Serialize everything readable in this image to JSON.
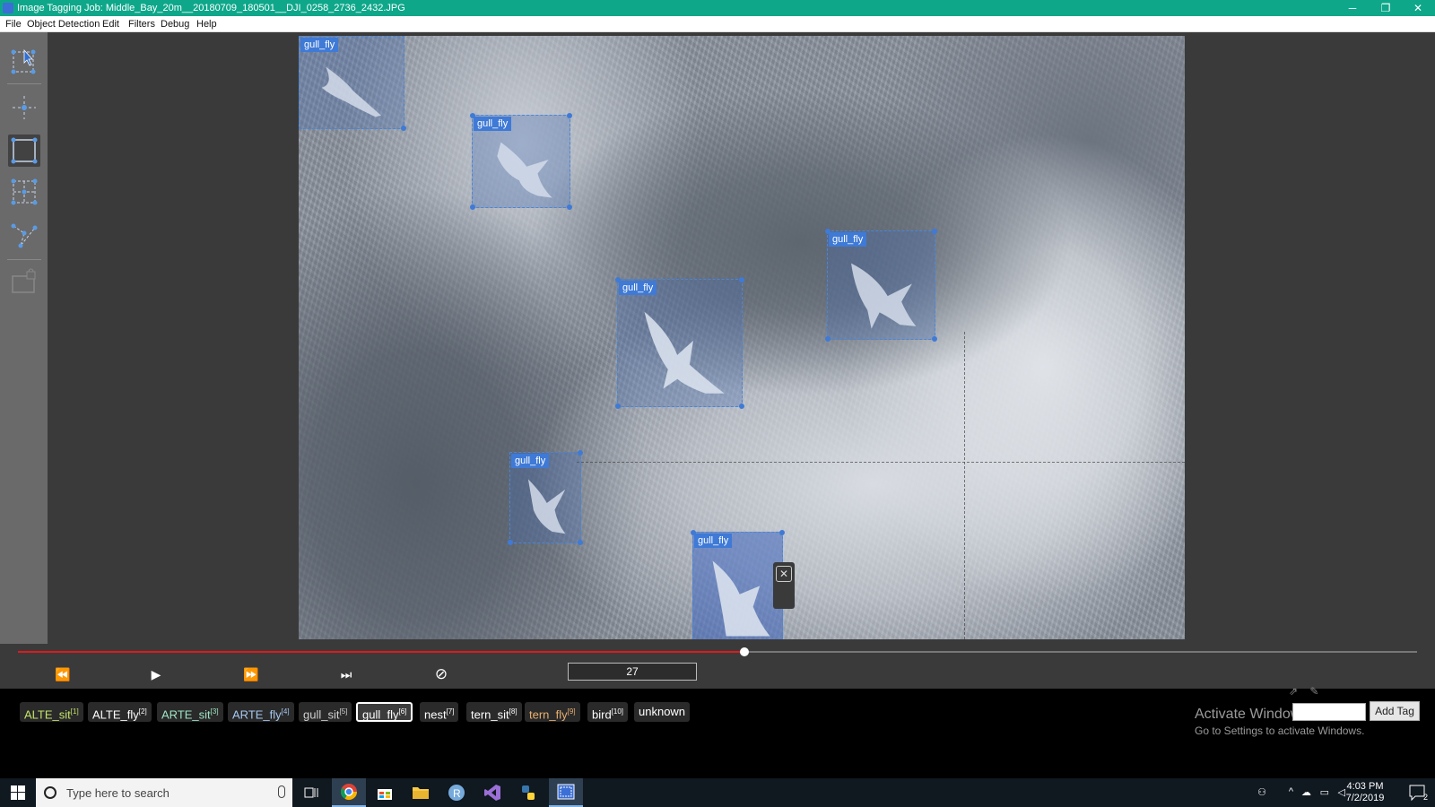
{
  "window": {
    "title": "Image Tagging Job: Middle_Bay_20m__20180709_180501__DJI_0258_2736_2432.JPG",
    "minimize": "─",
    "restore": "❐",
    "close": "✕"
  },
  "menu": [
    "File",
    "Object Detection",
    "Edit",
    "Filters",
    "Debug",
    "Help"
  ],
  "tools": [
    {
      "name": "select-tool-icon",
      "active": false
    },
    {
      "name": "point-tool-icon",
      "active": false
    },
    {
      "name": "rectangle-tool-icon",
      "active": true
    },
    {
      "name": "polygon-tool-icon",
      "active": false
    },
    {
      "name": "polyline-tool-icon",
      "active": false
    },
    {
      "name": "lock-region-icon",
      "active": false
    }
  ],
  "regions": [
    {
      "tag": "gull_fly"
    },
    {
      "tag": "gull_fly"
    },
    {
      "tag": "gull_fly"
    },
    {
      "tag": "gull_fly"
    },
    {
      "tag": "gull_fly"
    },
    {
      "tag": "gull_fly"
    }
  ],
  "region_colors": {
    "fill": "#466eb4",
    "border": "#4a86d8",
    "label": "#3f7ad6"
  },
  "timeline": {
    "progress_fraction": 0.519,
    "frame": "27",
    "buttons": {
      "prev": "⏪",
      "play": "▶",
      "next": "⏩",
      "next_tagged": "⏭",
      "skip": "⊘"
    }
  },
  "tags": [
    {
      "label": "ALTE_sit",
      "hotkey": "[1]",
      "color": "#c3e36a"
    },
    {
      "label": "ALTE_fly",
      "hotkey": "[2]",
      "color": "#ffffff"
    },
    {
      "label": "ARTE_sit",
      "hotkey": "[3]",
      "color": "#9fe3c4"
    },
    {
      "label": "ARTE_fly",
      "hotkey": "[4]",
      "color": "#a6c8f0"
    },
    {
      "label": "gull_sit",
      "hotkey": "[5]",
      "color": "#d0d0d0"
    },
    {
      "label": "gull_fly",
      "hotkey": "[6]",
      "color": "#ffffff"
    },
    {
      "label": "nest",
      "hotkey": "[7]",
      "color": "#ffffff"
    },
    {
      "label": "tern_sit",
      "hotkey": "[8]",
      "color": "#ffffff"
    },
    {
      "label": "tern_fly",
      "hotkey": "[9]",
      "color": "#e8b070"
    },
    {
      "label": "bird",
      "hotkey": "[10]",
      "color": "#ffffff"
    },
    {
      "label": "unknown",
      "hotkey": "",
      "color": "#ffffff"
    }
  ],
  "selected_tag": "gull_fly",
  "add_tag": {
    "input_value": "",
    "button_label": "Add Tag"
  },
  "watermark": {
    "line1": "Activate Windows",
    "line2": "Go to Settings to activate Windows."
  },
  "taskbar": {
    "search_placeholder": "Type here to search",
    "apps": [
      "task-view-icon",
      "chrome-icon",
      "store-icon",
      "file-explorer-icon",
      "r-app-icon",
      "visual-studio-icon",
      "python-app-icon",
      "tagging-app-icon"
    ],
    "time": "4:03 PM",
    "date": "7/2/2019",
    "notifications": "2"
  }
}
